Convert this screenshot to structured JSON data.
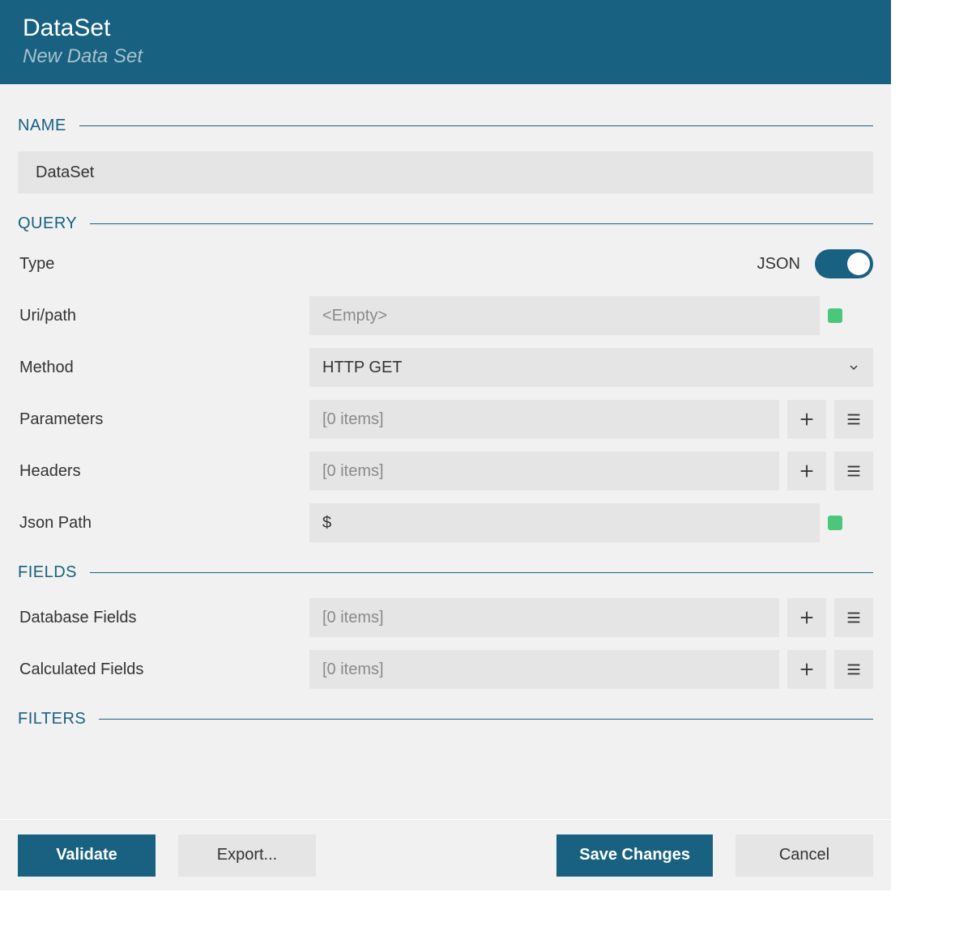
{
  "header": {
    "title": "DataSet",
    "subtitle": "New Data Set"
  },
  "sections": {
    "name": {
      "label": "NAME",
      "value": "DataSet"
    },
    "query": {
      "label": "QUERY",
      "type_label": "Type",
      "toggle_label": "JSON",
      "uri_label": "Uri/path",
      "uri_placeholder": "<Empty>",
      "method_label": "Method",
      "method_value": "HTTP GET",
      "parameters_label": "Parameters",
      "parameters_value": "[0 items]",
      "headers_label": "Headers",
      "headers_value": "[0 items]",
      "jsonpath_label": "Json Path",
      "jsonpath_value": "$"
    },
    "fields": {
      "label": "FIELDS",
      "db_label": "Database Fields",
      "db_value": "[0 items]",
      "calc_label": "Calculated Fields",
      "calc_value": "[0 items]"
    },
    "filters": {
      "label": "FILTERS"
    }
  },
  "footer": {
    "validate": "Validate",
    "export": "Export...",
    "save": "Save Changes",
    "cancel": "Cancel"
  }
}
